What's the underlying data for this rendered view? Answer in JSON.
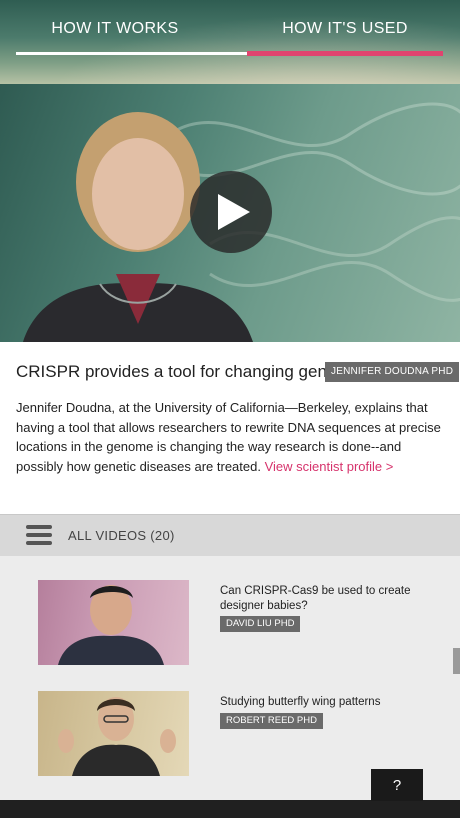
{
  "tabs": [
    {
      "label": "HOW IT WORKS",
      "active": false
    },
    {
      "label": "HOW IT'S USED",
      "active": true
    }
  ],
  "accent_color": "#e0446f",
  "video": {
    "play_icon": "play-icon",
    "title": "CRISPR provides a tool for changing genes",
    "speaker_badge": "JENNIFER DOUDNA PHD",
    "description": "Jennifer Doudna, at the University of California—Berkeley, explains that having a tool that allows researchers to rewrite DNA sequences at precise locations in the genome is changing the way research is done--and possibly how genetic diseases are treated.",
    "profile_link": "View scientist profile >"
  },
  "videos_section": {
    "menu_icon": "hamburger-menu-icon",
    "label": "ALL VIDEOS (20)"
  },
  "video_list": [
    {
      "title": "Can CRISPR-Cas9 be used to create designer babies?",
      "speaker": "DAVID LIU PHD"
    },
    {
      "title": "Studying butterfly wing patterns",
      "speaker": "ROBERT REED PHD"
    }
  ],
  "help_button": "?"
}
